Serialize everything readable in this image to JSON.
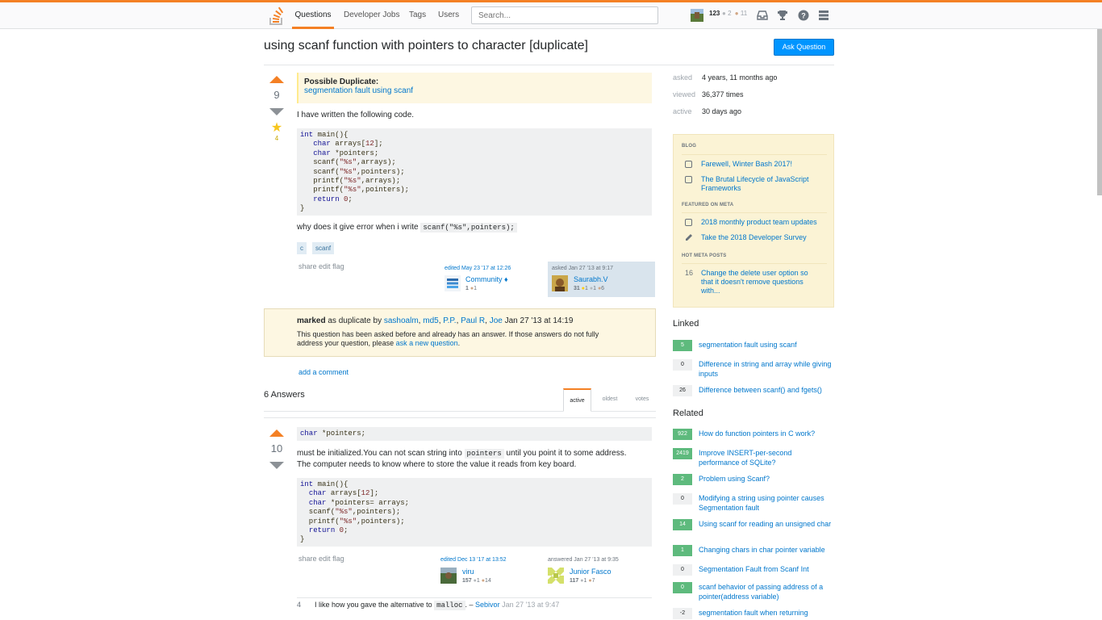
{
  "nav": {
    "items": [
      "Questions",
      "Developer Jobs",
      "Tags",
      "Users"
    ],
    "search_placeholder": "Search...",
    "reputation": "123",
    "silver": "2",
    "bronze": "11"
  },
  "question": {
    "title": "using scanf function with pointers to character [duplicate]",
    "ask_button": "Ask Question",
    "votes": "9",
    "favorites": "4",
    "duplicate_heading": "Possible Duplicate:",
    "duplicate_link": "segmentation fault using scanf",
    "intro": "I have written the following code.",
    "code_lines": [
      "int main(){",
      "   char arrays[12];",
      "   char *pointers;",
      "   scanf(\"%s\",arrays);",
      "   scanf(\"%s\",pointers);",
      "   printf(\"%s\",arrays);",
      "   printf(\"%s\",pointers);",
      "   return 0;",
      "}"
    ],
    "why_text": "why does it give error when i write",
    "why_code": "scanf(\"%s\",pointers);",
    "tags": [
      "c",
      "scanf"
    ],
    "menu": [
      "share",
      "edit",
      "flag"
    ],
    "edited_label": "edited May 23 '17 at 12:26",
    "editor_name": "Community ♦",
    "editor_rep": "1",
    "editor_bronze": "1",
    "asked_label": "asked Jan 27 '13 at 9:17",
    "owner_name": "Saurabh.V",
    "owner_rep": "31",
    "owner_gold": "1",
    "owner_silver": "1",
    "owner_bronze": "6"
  },
  "closed": {
    "marked": "marked",
    "as_dup_text": "as duplicate by",
    "users": [
      "sashoalm",
      "md5",
      "P.P.",
      "Paul R",
      "Joe"
    ],
    "date": "Jan 27 '13 at 14:19",
    "body": "This question has been asked before and already has an answer. If those answers do not fully address your question, please",
    "ask_new": "ask a new question",
    "period": "."
  },
  "add_comment": "add a comment",
  "answers": {
    "heading": "6 Answers",
    "tabs": [
      "active",
      "oldest",
      "votes"
    ],
    "first": {
      "votes": "10",
      "code_top": "char *pointers;",
      "text1a": "must be initialized.You can not scan string into",
      "text1_code": "pointers",
      "text1b": "until you point it to some address.",
      "text2": "The computer needs to know where to store the value it reads from key board.",
      "code_lines": [
        "int main(){",
        "  char arrays[12];",
        "  char *pointers= arrays;",
        "  scanf(\"%s\",pointers);",
        "  printf(\"%s\",pointers);",
        "  return 0;",
        "}"
      ],
      "menu": [
        "share",
        "edit",
        "flag"
      ],
      "edited_label": "edited Dec 13 '17 at 13:52",
      "editor_name": "viru",
      "editor_rep": "157",
      "editor_silver": "1",
      "editor_bronze": "14",
      "answered_label": "answered Jan 27 '13 at 9:35",
      "author_name": "Junior Fasco",
      "author_rep": "117",
      "author_silver": "1",
      "author_bronze": "7",
      "comment_score": "4",
      "comment_text": "I like how you gave the alternative to",
      "comment_code": "malloc",
      "comment_dash": ". –",
      "comment_user": "Sebivor",
      "comment_date": "Jan 27 '13 at 9:47"
    }
  },
  "sidebar": {
    "stats": [
      {
        "label": "asked",
        "value": "4 years, 11 months ago"
      },
      {
        "label": "viewed",
        "value": "36,377 times"
      },
      {
        "label": "active",
        "value": "30 days ago"
      }
    ],
    "blog_heading": "BLOG",
    "blog": [
      "Farewell, Winter Bash 2017!",
      "The Brutal Lifecycle of JavaScript Frameworks"
    ],
    "meta_heading": "FEATURED ON META",
    "meta": [
      "2018 monthly product team updates",
      "Take the 2018 Developer Survey"
    ],
    "hot_heading": "HOT META POSTS",
    "hot": [
      {
        "score": "16",
        "text": "Change the delete user option so that it doesn't remove questions with..."
      }
    ],
    "linked_heading": "Linked",
    "linked": [
      {
        "score": "5",
        "text": "segmentation fault using scanf",
        "answered": true
      },
      {
        "score": "0",
        "text": "Difference in string and array while giving inputs",
        "answered": false
      },
      {
        "score": "26",
        "text": "Difference between scanf() and fgets()",
        "answered": false
      }
    ],
    "related_heading": "Related",
    "related": [
      {
        "score": "922",
        "text": "How do function pointers in C work?",
        "answered": true
      },
      {
        "score": "2419",
        "text": "Improve INSERT-per-second performance of SQLite?",
        "answered": true
      },
      {
        "score": "2",
        "text": "Problem using Scanf?",
        "answered": true
      },
      {
        "score": "0",
        "text": "Modifying a string using pointer causes Segmentation fault",
        "answered": false
      },
      {
        "score": "14",
        "text": "Using scanf for reading an unsigned char",
        "answered": true
      },
      {
        "score": "1",
        "text": "Changing chars in char pointer variable",
        "answered": true
      },
      {
        "score": "0",
        "text": "Segmentation Fault from Scanf Int",
        "answered": false
      },
      {
        "score": "0",
        "text": "scanf behavior of passing address of a pointer(address variable)",
        "answered": true
      },
      {
        "score": "-2",
        "text": "segmentation fault when returning",
        "answered": false
      }
    ]
  },
  "colors": {
    "accent": "#f48024",
    "link": "#0077cc",
    "answered": "#5eba7d"
  }
}
